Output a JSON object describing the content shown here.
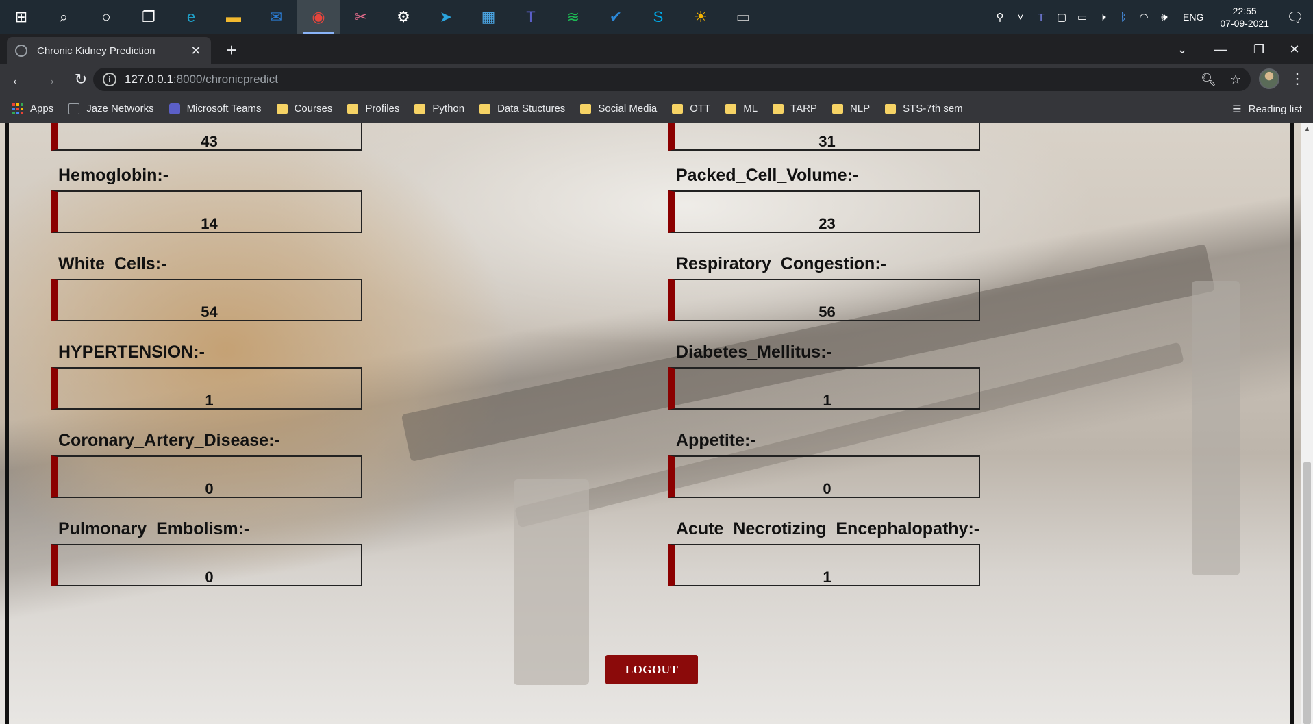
{
  "taskbar": {
    "apps": [
      {
        "name": "start-icon",
        "glyph": "⊞",
        "color": "#ffffff"
      },
      {
        "name": "search-icon",
        "glyph": "⌕",
        "color": "#ffffff"
      },
      {
        "name": "cortana-icon",
        "glyph": "○",
        "color": "#ffffff"
      },
      {
        "name": "task-view-icon",
        "glyph": "❐",
        "color": "#ffffff"
      },
      {
        "name": "edge-icon",
        "glyph": "e",
        "color": "#1fa0c8"
      },
      {
        "name": "file-explorer-icon",
        "glyph": "▬",
        "color": "#f2b92f"
      },
      {
        "name": "mail-icon",
        "glyph": "✉",
        "color": "#2b7cd3"
      },
      {
        "name": "chrome-icon",
        "glyph": "◉",
        "color": "#e8453c"
      },
      {
        "name": "snip-icon",
        "glyph": "✂",
        "color": "#e06a8a"
      },
      {
        "name": "settings-icon",
        "glyph": "⚙",
        "color": "#ffffff"
      },
      {
        "name": "telegram-icon",
        "glyph": "➤",
        "color": "#2aa3dc"
      },
      {
        "name": "store-icon",
        "glyph": "▦",
        "color": "#4aa3e0"
      },
      {
        "name": "teams-icon",
        "glyph": "T",
        "color": "#5b5fc7"
      },
      {
        "name": "spotify-icon",
        "glyph": "≋",
        "color": "#1db954"
      },
      {
        "name": "todo-icon",
        "glyph": "✔",
        "color": "#2b88d8"
      },
      {
        "name": "skype-icon",
        "glyph": "S",
        "color": "#00a8e6"
      },
      {
        "name": "weather-icon",
        "glyph": "☀",
        "color": "#f5b400"
      },
      {
        "name": "terminal-icon",
        "glyph": "▭",
        "color": "#cccccc"
      }
    ],
    "tray": {
      "language": "ENG",
      "time": "22:55",
      "date": "07-09-2021"
    }
  },
  "browser": {
    "tab_title": "Chronic Kidney Prediction",
    "url_host": "127.0.0.1",
    "url_path": ":8000/chronicpredict",
    "bookmarks": [
      {
        "label": "Apps",
        "type": "apps"
      },
      {
        "label": "Jaze Networks",
        "type": "page"
      },
      {
        "label": "Microsoft Teams",
        "type": "teams"
      },
      {
        "label": "Courses",
        "type": "folder"
      },
      {
        "label": "Profiles",
        "type": "folder"
      },
      {
        "label": "Python",
        "type": "folder"
      },
      {
        "label": "Data Stuctures",
        "type": "folder"
      },
      {
        "label": "Social Media",
        "type": "folder"
      },
      {
        "label": "OTT",
        "type": "folder"
      },
      {
        "label": "ML",
        "type": "folder"
      },
      {
        "label": "TARP",
        "type": "folder"
      },
      {
        "label": "NLP",
        "type": "folder"
      },
      {
        "label": "STS-7th sem",
        "type": "folder"
      }
    ],
    "reading_list": "Reading list"
  },
  "page": {
    "top_values": {
      "left": "43",
      "right": "31"
    },
    "fields": [
      {
        "label": "Hemoglobin:-",
        "value": "14"
      },
      {
        "label": "Packed_Cell_Volume:-",
        "value": "23"
      },
      {
        "label": "White_Cells:-",
        "value": "54"
      },
      {
        "label": "Respiratory_Congestion:-",
        "value": "56"
      },
      {
        "label": "HYPERTENSION:-",
        "value": "1"
      },
      {
        "label": "Diabetes_Mellitus:-",
        "value": "1"
      },
      {
        "label": "Coronary_Artery_Disease:-",
        "value": "0"
      },
      {
        "label": "Appetite:-",
        "value": "0"
      },
      {
        "label": "Pulmonary_Embolism:-",
        "value": "0"
      },
      {
        "label": "Acute_Necrotizing_Encephalopathy:-",
        "value": "1"
      }
    ],
    "logout_label": "LOGOUT",
    "accent_color": "#8b0000"
  }
}
